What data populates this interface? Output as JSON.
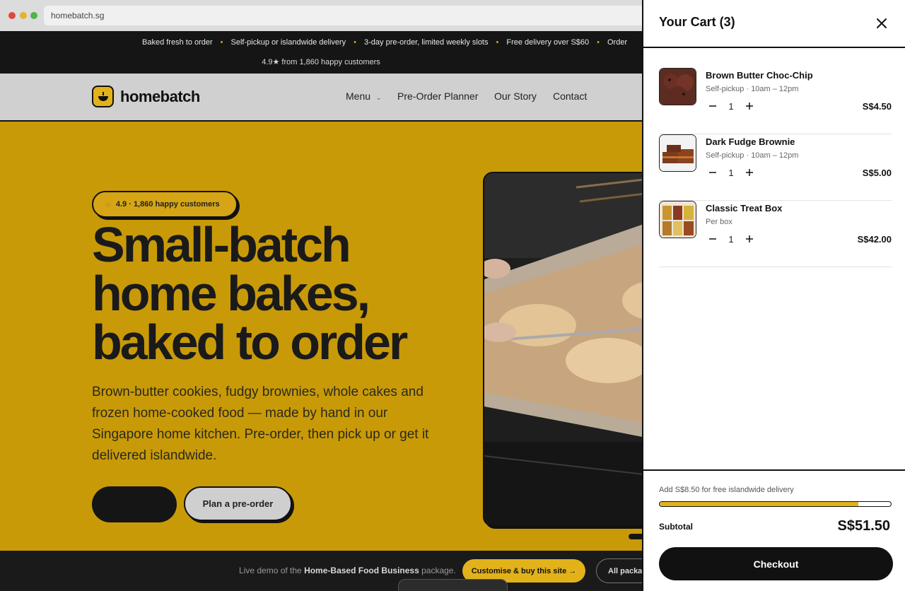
{
  "browser": {
    "url": "homebatch.sg",
    "dot_colors": [
      "#e0483e",
      "#e5b232",
      "#4fb446"
    ]
  },
  "announcement": {
    "items": [
      "Baked fresh to order",
      "Self-pickup or islandwide delivery",
      "3-day pre-order, limited weekly slots",
      "Free delivery over S$60",
      "Order"
    ],
    "rating_line": "4.9★ from 1,860 happy customers"
  },
  "header": {
    "logo_text": "homebatch",
    "nav": {
      "menu": "Menu",
      "planner": "Pre-Order Planner",
      "story": "Our Story",
      "contact": "Contact"
    }
  },
  "hero": {
    "badge": "4.9 · 1,860 happy customers",
    "headline": "Small-batch home bakes, baked to order",
    "description": "Brown-butter cookies, fudgy brownies, whole cakes and frozen home-cooked food — made by hand in our Singapore home kitchen. Pre-order, then pick up or get it delivered islandwide.",
    "primary_button": "",
    "secondary_button": "Plan a pre-order"
  },
  "demo_bar": {
    "text_prefix": "Live demo of the ",
    "text_bold": "Home-Based Food Business",
    "text_suffix": " package.",
    "cta": "Customise & buy this site →",
    "all_packages": "All packa"
  },
  "cart": {
    "title": "Your Cart (3)",
    "items": [
      {
        "name": "Brown Butter Choc-Chip",
        "sub": "Self-pickup · 10am – 12pm",
        "qty": "1",
        "price": "S$4.50"
      },
      {
        "name": "Dark Fudge Brownie",
        "sub": "Self-pickup · 10am – 12pm",
        "qty": "1",
        "price": "S$5.00"
      },
      {
        "name": "Classic Treat Box",
        "sub": "Per box",
        "qty": "1",
        "price": "S$42.00"
      }
    ],
    "free_delivery_note": "Add S$8.50 for free islandwide delivery",
    "free_delivery_progress": 0.86,
    "subtotal_label": "Subtotal",
    "subtotal_value": "S$51.50",
    "checkout_label": "Checkout"
  },
  "colors": {
    "accent": "#e2b21b",
    "hero_bg": "#c99a08",
    "dark": "#111111"
  }
}
